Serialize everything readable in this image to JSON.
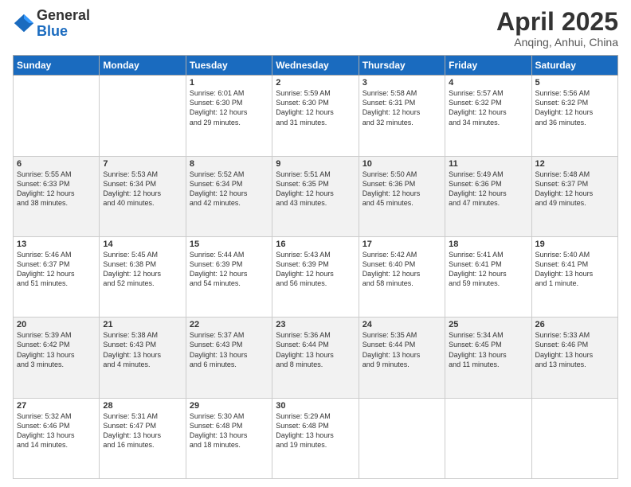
{
  "header": {
    "logo_general": "General",
    "logo_blue": "Blue",
    "month_title": "April 2025",
    "location": "Anqing, Anhui, China"
  },
  "days_of_week": [
    "Sunday",
    "Monday",
    "Tuesday",
    "Wednesday",
    "Thursday",
    "Friday",
    "Saturday"
  ],
  "weeks": [
    [
      {
        "day": "",
        "info": ""
      },
      {
        "day": "",
        "info": ""
      },
      {
        "day": "1",
        "info": "Sunrise: 6:01 AM\nSunset: 6:30 PM\nDaylight: 12 hours\nand 29 minutes."
      },
      {
        "day": "2",
        "info": "Sunrise: 5:59 AM\nSunset: 6:30 PM\nDaylight: 12 hours\nand 31 minutes."
      },
      {
        "day": "3",
        "info": "Sunrise: 5:58 AM\nSunset: 6:31 PM\nDaylight: 12 hours\nand 32 minutes."
      },
      {
        "day": "4",
        "info": "Sunrise: 5:57 AM\nSunset: 6:32 PM\nDaylight: 12 hours\nand 34 minutes."
      },
      {
        "day": "5",
        "info": "Sunrise: 5:56 AM\nSunset: 6:32 PM\nDaylight: 12 hours\nand 36 minutes."
      }
    ],
    [
      {
        "day": "6",
        "info": "Sunrise: 5:55 AM\nSunset: 6:33 PM\nDaylight: 12 hours\nand 38 minutes."
      },
      {
        "day": "7",
        "info": "Sunrise: 5:53 AM\nSunset: 6:34 PM\nDaylight: 12 hours\nand 40 minutes."
      },
      {
        "day": "8",
        "info": "Sunrise: 5:52 AM\nSunset: 6:34 PM\nDaylight: 12 hours\nand 42 minutes."
      },
      {
        "day": "9",
        "info": "Sunrise: 5:51 AM\nSunset: 6:35 PM\nDaylight: 12 hours\nand 43 minutes."
      },
      {
        "day": "10",
        "info": "Sunrise: 5:50 AM\nSunset: 6:36 PM\nDaylight: 12 hours\nand 45 minutes."
      },
      {
        "day": "11",
        "info": "Sunrise: 5:49 AM\nSunset: 6:36 PM\nDaylight: 12 hours\nand 47 minutes."
      },
      {
        "day": "12",
        "info": "Sunrise: 5:48 AM\nSunset: 6:37 PM\nDaylight: 12 hours\nand 49 minutes."
      }
    ],
    [
      {
        "day": "13",
        "info": "Sunrise: 5:46 AM\nSunset: 6:37 PM\nDaylight: 12 hours\nand 51 minutes."
      },
      {
        "day": "14",
        "info": "Sunrise: 5:45 AM\nSunset: 6:38 PM\nDaylight: 12 hours\nand 52 minutes."
      },
      {
        "day": "15",
        "info": "Sunrise: 5:44 AM\nSunset: 6:39 PM\nDaylight: 12 hours\nand 54 minutes."
      },
      {
        "day": "16",
        "info": "Sunrise: 5:43 AM\nSunset: 6:39 PM\nDaylight: 12 hours\nand 56 minutes."
      },
      {
        "day": "17",
        "info": "Sunrise: 5:42 AM\nSunset: 6:40 PM\nDaylight: 12 hours\nand 58 minutes."
      },
      {
        "day": "18",
        "info": "Sunrise: 5:41 AM\nSunset: 6:41 PM\nDaylight: 12 hours\nand 59 minutes."
      },
      {
        "day": "19",
        "info": "Sunrise: 5:40 AM\nSunset: 6:41 PM\nDaylight: 13 hours\nand 1 minute."
      }
    ],
    [
      {
        "day": "20",
        "info": "Sunrise: 5:39 AM\nSunset: 6:42 PM\nDaylight: 13 hours\nand 3 minutes."
      },
      {
        "day": "21",
        "info": "Sunrise: 5:38 AM\nSunset: 6:43 PM\nDaylight: 13 hours\nand 4 minutes."
      },
      {
        "day": "22",
        "info": "Sunrise: 5:37 AM\nSunset: 6:43 PM\nDaylight: 13 hours\nand 6 minutes."
      },
      {
        "day": "23",
        "info": "Sunrise: 5:36 AM\nSunset: 6:44 PM\nDaylight: 13 hours\nand 8 minutes."
      },
      {
        "day": "24",
        "info": "Sunrise: 5:35 AM\nSunset: 6:44 PM\nDaylight: 13 hours\nand 9 minutes."
      },
      {
        "day": "25",
        "info": "Sunrise: 5:34 AM\nSunset: 6:45 PM\nDaylight: 13 hours\nand 11 minutes."
      },
      {
        "day": "26",
        "info": "Sunrise: 5:33 AM\nSunset: 6:46 PM\nDaylight: 13 hours\nand 13 minutes."
      }
    ],
    [
      {
        "day": "27",
        "info": "Sunrise: 5:32 AM\nSunset: 6:46 PM\nDaylight: 13 hours\nand 14 minutes."
      },
      {
        "day": "28",
        "info": "Sunrise: 5:31 AM\nSunset: 6:47 PM\nDaylight: 13 hours\nand 16 minutes."
      },
      {
        "day": "29",
        "info": "Sunrise: 5:30 AM\nSunset: 6:48 PM\nDaylight: 13 hours\nand 18 minutes."
      },
      {
        "day": "30",
        "info": "Sunrise: 5:29 AM\nSunset: 6:48 PM\nDaylight: 13 hours\nand 19 minutes."
      },
      {
        "day": "",
        "info": ""
      },
      {
        "day": "",
        "info": ""
      },
      {
        "day": "",
        "info": ""
      }
    ]
  ]
}
